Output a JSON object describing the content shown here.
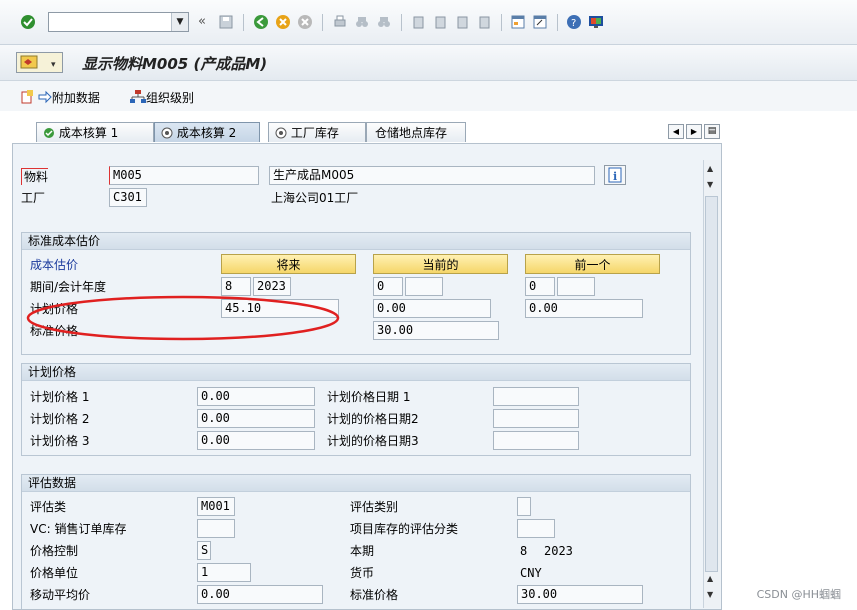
{
  "toolbar": {
    "command_value": "",
    "icons": [
      "enter-icon",
      "back-arrows-icon",
      "save-icon",
      "back-icon",
      "exit-icon",
      "cancel-icon",
      "print-icon",
      "find-icon",
      "find-next-icon",
      "first-page-icon",
      "prev-page-icon",
      "next-page-icon",
      "last-page-icon",
      "new-session-icon",
      "shortcut-icon",
      "help-icon",
      "customize-layout-icon"
    ]
  },
  "title": "显示物料M005 (产成品M)",
  "app_toolbar": {
    "additional_data": "附加数据",
    "org_levels": "组织级别"
  },
  "tabs": [
    {
      "label": "成本核算 1"
    },
    {
      "label": "成本核算 2"
    },
    {
      "label": "工厂库存"
    },
    {
      "label": "仓储地点库存"
    }
  ],
  "header": {
    "material_label": "物料",
    "material_value": "M005",
    "material_desc": "生产成品M005",
    "plant_label": "工厂",
    "plant_value": "C301",
    "plant_desc": "上海公司01工厂"
  },
  "std_cost": {
    "title": "标准成本估价",
    "cost_estimate": "成本估价",
    "btn_future": "将来",
    "btn_current": "当前的",
    "btn_previous": "前一个",
    "period_label": "期间/会计年度",
    "future_period": "8",
    "future_year": "2023",
    "current_period": "0",
    "current_year": "",
    "previous_period": "0",
    "previous_year": "",
    "planned_price_label": "计划价格",
    "future_planned": "45.10",
    "current_planned": "0.00",
    "previous_planned": "0.00",
    "standard_price_label": "标准价格",
    "current_standard": "30.00"
  },
  "planned_prices": {
    "title": "计划价格",
    "p1_label": "计划价格 1",
    "p1_value": "0.00",
    "p2_label": "计划价格 2",
    "p2_value": "0.00",
    "p3_label": "计划价格 3",
    "p3_value": "0.00",
    "d1_label": "计划价格日期 1",
    "d1_value": "",
    "d2_label": "计划的价格日期2",
    "d2_value": "",
    "d3_label": "计划的价格日期3",
    "d3_value": ""
  },
  "valuation": {
    "title": "评估数据",
    "val_class_label": "评估类",
    "val_class_value": "M001",
    "vc_label": "VC: 销售订单库存",
    "vc_value": "",
    "price_control_label": "价格控制",
    "price_control_value": "S",
    "price_unit_label": "价格单位",
    "price_unit_value": "1",
    "mov_avg_label": "移动平均价",
    "mov_avg_value": "0.00",
    "val_category_label": "评估类别",
    "val_category_value": "",
    "proj_stock_label": "项目库存的评估分类",
    "proj_stock_value": "",
    "period_label": "本期",
    "period_value": "8",
    "period_year": "2023",
    "currency_label": "货币",
    "currency_value": "CNY",
    "std_price_label": "标准价格",
    "std_price_value": "30.00"
  },
  "watermark": "CSDN @HH蝈蝈",
  "colors": {
    "annotation": "#e02020",
    "button": "#f5d66a",
    "link": "#1b3a9c"
  }
}
